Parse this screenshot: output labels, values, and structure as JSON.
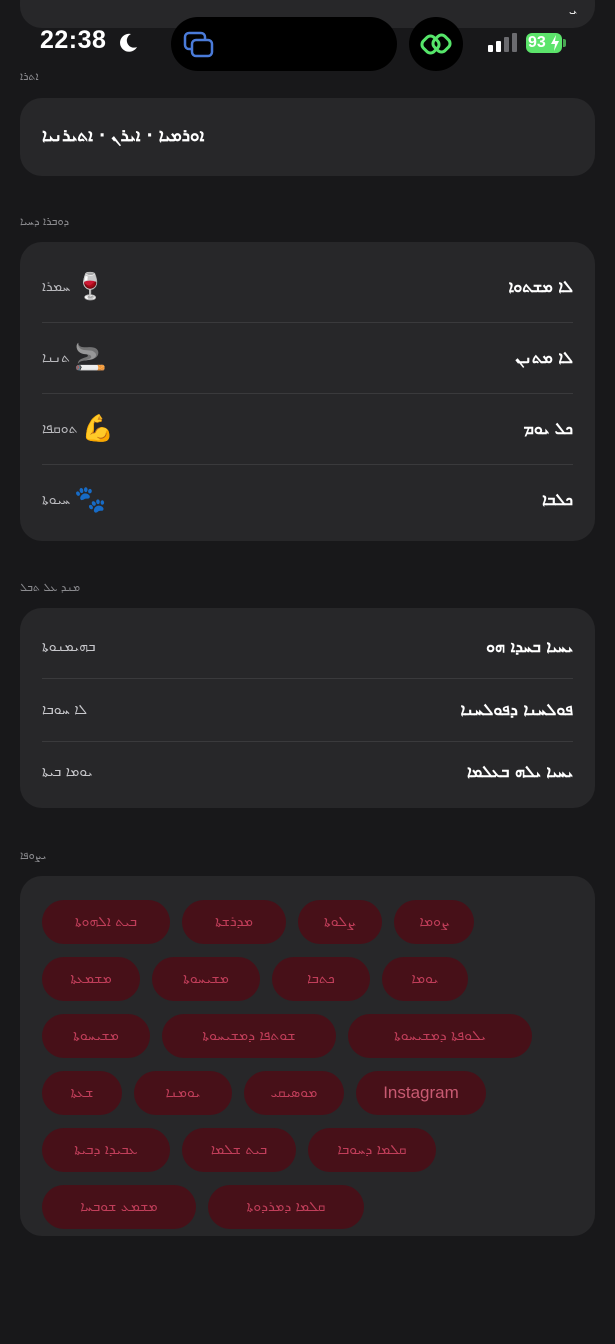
{
  "status_bar": {
    "time": "22:38",
    "battery": "93"
  },
  "top_partial": {
    "glyph": "ܝ"
  },
  "location": {
    "header": "ܐܬܪܐ",
    "value": "ܐܘܪܡܝܐ · ܐܝܪܢ · ܐܬܝܪܢܝܐ"
  },
  "lifestyle": {
    "header": "ܕܘܒܪܐ ܕܚܝܐ",
    "rows": [
      {
        "label": "ܠܐ ܡܫܬܘܐ",
        "value": "ܚܡܪܐ",
        "emoji": "🍷"
      },
      {
        "label": "ܠܐ ܡܬܢܢ",
        "value": "ܬܢܢܐ",
        "emoji": "🚬"
      },
      {
        "label": "ܟܠ ܝܘܡ",
        "value": "ܬܘܩܦܐ",
        "emoji": "💪"
      },
      {
        "label": "ܟܠܒܐ",
        "value": "ܚܝܘܬܐ",
        "emoji": "🐾"
      }
    ]
  },
  "values": {
    "header": "ܡܢܕ ܥܠ ܬܒܠ",
    "rows": [
      {
        "label": "ܝܚܝܐ ܒܚܕܐ ܗܘ",
        "value": "ܒܗܝܡܢܘܬܐ"
      },
      {
        "label": "ܦܘܠܚܢܐ ܕܦܘܠܚܢܐ",
        "value": "ܠܐ ܚܘܒܐ"
      },
      {
        "label": "ܝܚܝܐ ܝܠܗ ܒܥܠܡܐ",
        "value": "ܝܘܡܐ ܒܝܬܐ"
      }
    ]
  },
  "interests": {
    "header": "ܝܨܘܦܐ",
    "chips": [
      [
        "ܒܝܬ ܐܠܗܘܬܐ",
        "ܡܕܪܫܬܐ",
        "ܨܠܘܬܐ",
        "ܨܘܡܐ"
      ],
      [
        "ܡܫܡܥܬܐ",
        "ܡܫܝܚܘܬܐ",
        "ܟܬܒܐ",
        "ܝܘܡܐ"
      ],
      [
        "ܡܫܝܚܘܬܐ",
        "ܫܘܬܦܐ ܕܡܫܝܚܘܬܐ",
        "ܝܠܘܦܬܐ ܕܡܫܝܚܘܬܐ"
      ],
      [
        "ܫܥܬܐ",
        "ܝܘܡܢܐ",
        "ܡܘܣܝܩܝ",
        "Instagram"
      ],
      [
        "ܥܒܝܕܐ ܕܒܝܬܐ",
        "ܒܝܬ ܫܠܡܐ",
        "ܩܠܡܐ ܕܚܘܒܐ"
      ],
      [
        "ܡܫܡܥ ܫܘܒܚܐ",
        "ܩܠܡܐ ܕܡܪܕܘܬܐ"
      ]
    ],
    "colors": {
      "chip_bg": "#471018",
      "chip_text": "#c13e5a"
    }
  }
}
